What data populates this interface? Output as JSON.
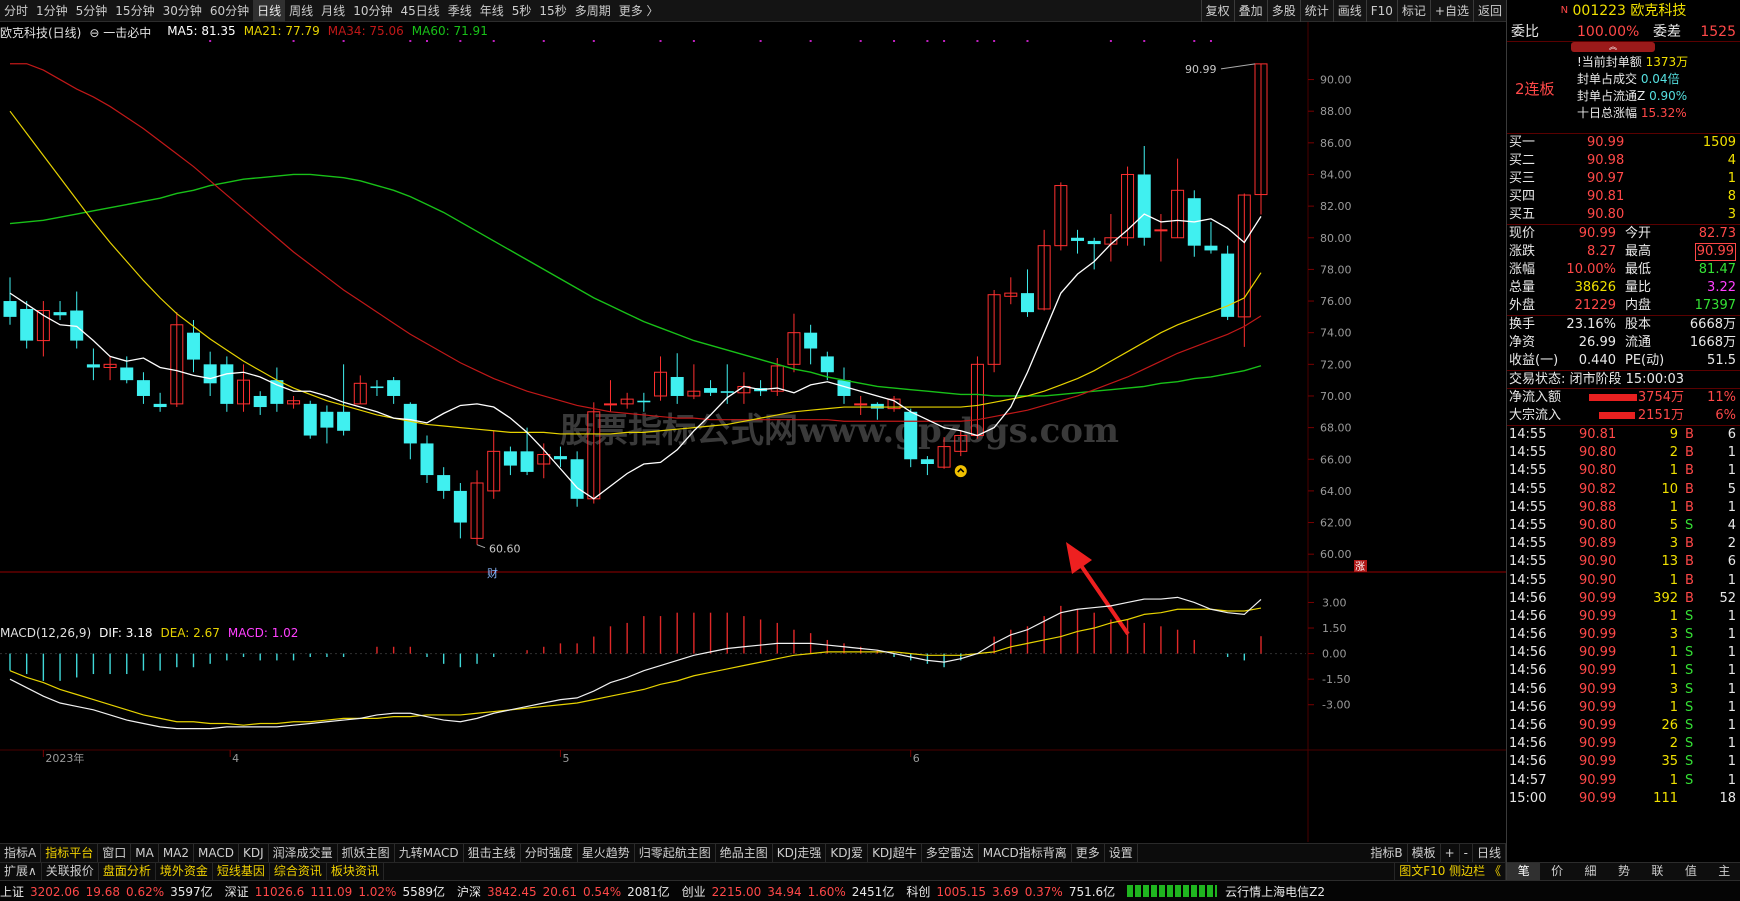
{
  "toolbar": {
    "periods": [
      "分时",
      "1分钟",
      "5分钟",
      "15分钟",
      "30分钟",
      "60分钟",
      "日线",
      "周线",
      "月线",
      "10分钟",
      "45日线",
      "季线",
      "年线",
      "5秒",
      "15秒",
      "多周期",
      "更多 〉"
    ],
    "active": "日线",
    "right": [
      "复权",
      "叠加",
      "多股",
      "统计",
      "画线",
      "F10",
      "标记",
      "+自选",
      "返回"
    ]
  },
  "chart_info": {
    "name": "欧克科技(日线)",
    "formula": "一击必中",
    "ma5": "MA5: 81.35",
    "ma21": "MA21: 77.79",
    "ma34": "MA34: 75.06",
    "ma60": "MA60: 71.91",
    "macd_title": "MACD(12,26,9)",
    "dif": "DIF: 3.18",
    "dea": "DEA: 2.67",
    "macd": "MACD: 1.02"
  },
  "chart_data": {
    "type": "candlestick",
    "dates": [
      "2023年",
      "4",
      "5",
      "6"
    ],
    "price_ticks": [
      "90.00",
      "88.00",
      "86.00",
      "84.00",
      "82.00",
      "80.00",
      "78.00",
      "76.00",
      "74.00",
      "72.00",
      "70.00",
      "68.00",
      "66.00",
      "64.00",
      "62.00",
      "60.00"
    ],
    "macd_ticks": [
      "3.00",
      "1.50",
      "0.00",
      "-1.50",
      "-3.00"
    ],
    "ylim": [
      59,
      92.5
    ],
    "macd_ylim": [
      -4.6,
      4.2
    ],
    "high_label": "90.99",
    "low_label": "60.60",
    "watermark": "股票指标公式网www.gpzbgs.com",
    "marker_cai": "财",
    "marker_zhang": "涨",
    "candles": [
      [
        76,
        75,
        77.5,
        74.5
      ],
      [
        75.5,
        73.5,
        76,
        73
      ],
      [
        73.5,
        75.4,
        76,
        72.5
      ],
      [
        75.3,
        75.1,
        76,
        74.8
      ],
      [
        75.4,
        73.5,
        76.6,
        73
      ],
      [
        72,
        71.8,
        73,
        71
      ],
      [
        71.8,
        72,
        72.5,
        71
      ],
      [
        71.8,
        71,
        72.5,
        70.8
      ],
      [
        71,
        70,
        71.5,
        69.5
      ],
      [
        69.5,
        69.3,
        70.2,
        69
      ],
      [
        69.5,
        74.5,
        75.3,
        69.3
      ],
      [
        74,
        72.3,
        74.8,
        71.5
      ],
      [
        72,
        70.8,
        72.8,
        70
      ],
      [
        72,
        69.5,
        72.5,
        69
      ],
      [
        69.5,
        71,
        72,
        69
      ],
      [
        70,
        69.3,
        70.3,
        68.8
      ],
      [
        71,
        69.5,
        71.8,
        69
      ],
      [
        69.5,
        69.7,
        70,
        69.2
      ],
      [
        69.5,
        67.5,
        69.7,
        67.3
      ],
      [
        69,
        68,
        69.4,
        67
      ],
      [
        69,
        67.8,
        72,
        67.5
      ],
      [
        69.5,
        70.8,
        71.3,
        69.5
      ],
      [
        70.6,
        70.5,
        71,
        70
      ],
      [
        71,
        70,
        71.2,
        69.5
      ],
      [
        69.5,
        67,
        69.6,
        66
      ],
      [
        67,
        65,
        67.5,
        64.5
      ],
      [
        65,
        64,
        65.5,
        63.5
      ],
      [
        64,
        62,
        64.5,
        61
      ],
      [
        61,
        64.5,
        65.3,
        60.6
      ],
      [
        64,
        66.5,
        67.8,
        63.5
      ],
      [
        66.5,
        65.6,
        66.8,
        65
      ],
      [
        66.5,
        65.2,
        68,
        65
      ],
      [
        65.7,
        66.3,
        67,
        64.8
      ],
      [
        66.2,
        66,
        66.8,
        65.5
      ],
      [
        66,
        63.5,
        66.5,
        63
      ],
      [
        63.5,
        69,
        69.6,
        63.2
      ],
      [
        69.5,
        69.5,
        71,
        69
      ],
      [
        69.5,
        69.8,
        70.2,
        69.2
      ],
      [
        69.7,
        69.6,
        70.2,
        69
      ],
      [
        70,
        71.5,
        72.5,
        69.7
      ],
      [
        71.2,
        70,
        72.7,
        69.5
      ],
      [
        70,
        70.3,
        72,
        69.8
      ],
      [
        70.5,
        70.2,
        71,
        70
      ],
      [
        70.3,
        70.2,
        72,
        69.5
      ],
      [
        70.2,
        70.6,
        71.5,
        69.5
      ],
      [
        70.5,
        70.3,
        71,
        70
      ],
      [
        70.3,
        71.9,
        72.4,
        70
      ],
      [
        72,
        74,
        75.2,
        71.5
      ],
      [
        74,
        73,
        74.5,
        72
      ],
      [
        72.5,
        71.5,
        72.8,
        71
      ],
      [
        71,
        70,
        71.8,
        69.5
      ],
      [
        69.5,
        69.5,
        70,
        68.8
      ],
      [
        69.5,
        69.2,
        69.6,
        68.5
      ],
      [
        69.2,
        69.8,
        70,
        69
      ],
      [
        69,
        66,
        69.2,
        65.5
      ],
      [
        66,
        65.7,
        66.2,
        65
      ],
      [
        65.5,
        66.8,
        67.4,
        65.4
      ],
      [
        66.5,
        67.5,
        67.8,
        66.2
      ],
      [
        67.5,
        72,
        72.5,
        67.3
      ],
      [
        72,
        76.4,
        76.7,
        71.5
      ],
      [
        76.3,
        76.5,
        77.5,
        75.8
      ],
      [
        76.5,
        75.3,
        78,
        75
      ],
      [
        75.5,
        79.5,
        80.5,
        75.4
      ],
      [
        79.5,
        83.3,
        83.5,
        79.2
      ],
      [
        80,
        79.8,
        80.5,
        79
      ],
      [
        79.8,
        79.6,
        80,
        78
      ],
      [
        79.6,
        80,
        81.5,
        78.5
      ],
      [
        80,
        84,
        84.5,
        79.5
      ],
      [
        84,
        80,
        85.8,
        79.5
      ],
      [
        80.5,
        80.5,
        81.5,
        78.5
      ],
      [
        80,
        83,
        85,
        80
      ],
      [
        82.5,
        79.5,
        83,
        78.8
      ],
      [
        79.5,
        79.2,
        81,
        79
      ],
      [
        79,
        75,
        79.5,
        74.8
      ],
      [
        75,
        82.7,
        82.8,
        73.1
      ],
      [
        82.73,
        90.99,
        90.99,
        81.47
      ]
    ],
    "ma5": [
      76.5,
      75.8,
      75.1,
      74.5,
      74.4,
      73.5,
      72.5,
      72.2,
      72.4,
      71.8,
      71.6,
      71.3,
      71.1,
      71.4,
      71.5,
      71.2,
      70.7,
      70.3,
      70.3,
      70.0,
      69.6,
      69.3,
      69.0,
      68.6,
      68.5,
      68.3,
      68.9,
      69.4,
      69.5,
      69.3,
      68.6,
      67.7,
      66.6,
      65.4,
      64.2,
      63.5,
      64.3,
      65.1,
      65.7,
      65.8,
      66.6,
      67.8,
      68.8,
      69.9,
      70.6,
      70.4,
      70.5,
      70.2,
      70.7,
      70.9,
      70.6,
      70.3,
      70.0,
      69.7,
      69.0,
      68.5,
      68.0,
      67.8,
      67.5,
      68.0,
      69.3,
      71.5,
      74.0,
      76.5,
      77.7,
      78.5,
      79.6,
      80.5,
      81.5,
      81.0,
      81.1,
      81.0,
      81.2,
      80.6,
      79.7,
      81.35
    ],
    "ma21": [
      88.0,
      86.6,
      85.2,
      83.8,
      82.4,
      81.0,
      79.7,
      78.5,
      77.3,
      76.2,
      75.2,
      74.4,
      73.6,
      72.9,
      72.2,
      71.6,
      71.0,
      70.5,
      70.1,
      69.7,
      69.4,
      69.1,
      68.8,
      68.6,
      68.4,
      68.2,
      68.1,
      68.0,
      67.9,
      67.8,
      67.7,
      67.7,
      67.7,
      67.6,
      67.6,
      67.6,
      67.6,
      67.7,
      67.7,
      67.8,
      67.9,
      68.0,
      68.1,
      68.2,
      68.4,
      68.6,
      68.8,
      69.0,
      69.1,
      69.2,
      69.3,
      69.3,
      69.3,
      69.3,
      69.3,
      69.3,
      69.3,
      69.3,
      69.4,
      69.6,
      69.8,
      70.0,
      70.3,
      70.7,
      71.1,
      71.6,
      72.2,
      72.8,
      73.4,
      74.0,
      74.5,
      74.9,
      75.3,
      75.7,
      76.2,
      77.79
    ],
    "ma34": [
      91.0,
      91.0,
      90.6,
      90.0,
      89.4,
      88.9,
      88.3,
      87.6,
      86.9,
      86.1,
      85.3,
      84.5,
      83.6,
      82.7,
      81.8,
      80.9,
      80.0,
      79.1,
      78.3,
      77.5,
      76.7,
      76.0,
      75.3,
      74.6,
      73.9,
      73.3,
      72.7,
      72.1,
      71.6,
      71.1,
      70.7,
      70.3,
      70.0,
      69.7,
      69.4,
      69.2,
      69.0,
      68.9,
      68.8,
      68.7,
      68.6,
      68.6,
      68.5,
      68.5,
      68.5,
      68.5,
      68.5,
      68.5,
      68.5,
      68.5,
      68.4,
      68.4,
      68.4,
      68.4,
      68.4,
      68.4,
      68.4,
      68.4,
      68.5,
      68.7,
      68.9,
      69.1,
      69.4,
      69.7,
      70.0,
      70.4,
      70.8,
      71.2,
      71.7,
      72.2,
      72.7,
      73.1,
      73.5,
      73.9,
      74.4,
      75.06
    ],
    "ma60": [
      80.9,
      81.0,
      81.1,
      81.3,
      81.5,
      81.7,
      81.9,
      82.1,
      82.3,
      82.5,
      82.8,
      83.0,
      83.3,
      83.5,
      83.7,
      83.8,
      83.9,
      84.0,
      84.0,
      83.9,
      83.8,
      83.6,
      83.3,
      83.0,
      82.6,
      82.1,
      81.6,
      81.0,
      80.4,
      79.8,
      79.2,
      78.6,
      78.0,
      77.4,
      76.8,
      76.2,
      75.7,
      75.2,
      74.7,
      74.3,
      73.9,
      73.5,
      73.2,
      72.9,
      72.6,
      72.3,
      72.0,
      71.7,
      71.5,
      71.2,
      71.0,
      70.8,
      70.6,
      70.5,
      70.4,
      70.3,
      70.2,
      70.1,
      70.1,
      70.0,
      70.0,
      70.0,
      70.0,
      70.1,
      70.2,
      70.3,
      70.4,
      70.5,
      70.6,
      70.8,
      70.9,
      71.1,
      71.2,
      71.4,
      71.6,
      71.91
    ],
    "dif": [
      -1.5,
      -2.0,
      -2.5,
      -2.9,
      -3.1,
      -3.3,
      -3.6,
      -3.9,
      -4.1,
      -4.3,
      -4.4,
      -4.4,
      -4.4,
      -4.3,
      -4.3,
      -4.3,
      -4.3,
      -4.2,
      -4.1,
      -4.0,
      -3.9,
      -3.8,
      -3.6,
      -3.5,
      -3.5,
      -3.7,
      -3.9,
      -4.0,
      -3.8,
      -3.5,
      -3.3,
      -3.1,
      -2.9,
      -2.7,
      -2.6,
      -2.2,
      -1.7,
      -1.4,
      -1.0,
      -0.7,
      -0.4,
      -0.1,
      0.1,
      0.3,
      0.4,
      0.5,
      0.6,
      0.6,
      0.6,
      0.5,
      0.4,
      0.3,
      0.2,
      0.0,
      -0.2,
      -0.4,
      -0.5,
      -0.3,
      0.0,
      0.6,
      1.1,
      1.4,
      1.9,
      2.4,
      2.6,
      2.7,
      2.8,
      3.0,
      3.2,
      3.2,
      3.3,
      3.0,
      2.6,
      2.4,
      2.3,
      3.18
    ],
    "dea": [
      -1.0,
      -1.4,
      -1.7,
      -2.1,
      -2.4,
      -2.7,
      -3.0,
      -3.3,
      -3.6,
      -3.8,
      -4.0,
      -4.0,
      -4.1,
      -4.1,
      -4.2,
      -4.1,
      -4.1,
      -4.0,
      -4.0,
      -3.9,
      -3.8,
      -3.8,
      -3.8,
      -3.7,
      -3.7,
      -3.6,
      -3.6,
      -3.6,
      -3.5,
      -3.4,
      -3.3,
      -3.2,
      -3.1,
      -3.0,
      -2.9,
      -2.7,
      -2.5,
      -2.3,
      -2.1,
      -1.8,
      -1.6,
      -1.3,
      -1.1,
      -0.9,
      -0.7,
      -0.5,
      -0.3,
      -0.1,
      0.0,
      0.1,
      0.1,
      0.1,
      0.1,
      0.1,
      0.0,
      -0.1,
      -0.1,
      -0.1,
      0.0,
      0.1,
      0.4,
      0.6,
      0.8,
      1.0,
      1.3,
      1.5,
      1.8,
      2.0,
      2.3,
      2.4,
      2.6,
      2.6,
      2.6,
      2.5,
      2.5,
      2.67
    ],
    "signal_index": 57
  },
  "sidebar": {
    "logo": "N",
    "code": "001223",
    "name": "欧克科技",
    "weibi_label": "委比",
    "weibi": "100.00%",
    "weicha_label": "委差",
    "weicha": "1525",
    "lianban": "2连板",
    "seal": [
      [
        "!当前封单额",
        "1373万",
        "yel"
      ],
      [
        "封单占成交",
        "0.04倍",
        "cyn"
      ],
      [
        "封单占流通Z",
        "0.90%",
        "cyn"
      ],
      [
        "十日总涨幅",
        "15.32%",
        "red"
      ]
    ],
    "buy": [
      [
        "买一",
        "90.99",
        "1509"
      ],
      [
        "买二",
        "90.98",
        "4"
      ],
      [
        "买三",
        "90.97",
        "1"
      ],
      [
        "买四",
        "90.81",
        "8"
      ],
      [
        "买五",
        "90.80",
        "3"
      ]
    ],
    "quote": [
      [
        "现价",
        "90.99",
        "red",
        "今开",
        "82.73",
        "red"
      ],
      [
        "涨跌",
        "8.27",
        "red",
        "最高",
        "90.99",
        "red"
      ],
      [
        "涨幅",
        "10.00%",
        "red",
        "最低",
        "81.47",
        "grn"
      ],
      [
        "总量",
        "38626",
        "yel",
        "量比",
        "3.22",
        "mag"
      ],
      [
        "外盘",
        "21229",
        "red",
        "内盘",
        "17397",
        "grn"
      ]
    ],
    "stats": [
      [
        "换手",
        "23.16%",
        "股本",
        "6668万"
      ],
      [
        "净资",
        "26.99",
        "流通",
        "1668万"
      ],
      [
        "收益(一)",
        "0.440",
        "PE(动)",
        "51.5"
      ]
    ],
    "trade_status": "交易状态: 闭市阶段 15:00:03",
    "flow": [
      [
        "净流入额",
        "3754万",
        "11%"
      ],
      [
        "大宗流入",
        "2151万",
        "6%"
      ]
    ],
    "ticks": [
      [
        "14:55",
        "90.81",
        "9",
        "B",
        "6"
      ],
      [
        "14:55",
        "90.80",
        "2",
        "B",
        "1"
      ],
      [
        "14:55",
        "90.80",
        "1",
        "B",
        "1"
      ],
      [
        "14:55",
        "90.82",
        "10",
        "B",
        "5"
      ],
      [
        "14:55",
        "90.88",
        "1",
        "B",
        "1"
      ],
      [
        "14:55",
        "90.80",
        "5",
        "S",
        "4"
      ],
      [
        "14:55",
        "90.89",
        "3",
        "B",
        "2"
      ],
      [
        "14:55",
        "90.90",
        "13",
        "B",
        "6"
      ],
      [
        "14:55",
        "90.90",
        "1",
        "B",
        "1"
      ],
      [
        "14:56",
        "90.99",
        "392",
        "B",
        "52"
      ],
      [
        "14:56",
        "90.99",
        "1",
        "S",
        "1"
      ],
      [
        "14:56",
        "90.99",
        "3",
        "S",
        "1"
      ],
      [
        "14:56",
        "90.99",
        "1",
        "S",
        "1"
      ],
      [
        "14:56",
        "90.99",
        "1",
        "S",
        "1"
      ],
      [
        "14:56",
        "90.99",
        "3",
        "S",
        "1"
      ],
      [
        "14:56",
        "90.99",
        "1",
        "S",
        "1"
      ],
      [
        "14:56",
        "90.99",
        "26",
        "S",
        "1"
      ],
      [
        "14:56",
        "90.99",
        "2",
        "S",
        "1"
      ],
      [
        "14:56",
        "90.99",
        "35",
        "S",
        "1"
      ],
      [
        "14:57",
        "90.99",
        "1",
        "S",
        "1"
      ],
      [
        "15:00",
        "90.99",
        "111",
        "",
        "18"
      ]
    ],
    "tabs": [
      "笔",
      "价",
      "細",
      "势",
      "联",
      "值",
      "主"
    ]
  },
  "bottom_tabs": [
    "指标A",
    "指标平台",
    "窗口",
    "MA",
    "MA2",
    "MACD",
    "KDJ",
    "润泽成交量",
    "抓妖主图",
    "九转MACD",
    "狙击主线",
    "分时强度",
    "星火趋势",
    "归零起航主图",
    "绝品主图",
    "KDJ走强",
    "KDJ爱",
    "KDJ超牛",
    "多空雷达",
    "MACD指标背离",
    "更多",
    "设置"
  ],
  "bottom_tabs_right": [
    "指标B",
    "模板",
    "+",
    "-",
    "日线"
  ],
  "bottom_tabs2": [
    "扩展∧",
    "关联报价",
    "盘面分析",
    "境外资金",
    "短线基因",
    "综合资讯",
    "板块资讯"
  ],
  "bottom_tabs2_right": "图文F10 侧边栏 《",
  "status": [
    [
      "上证",
      "3202.06",
      "19.68",
      "0.62%",
      "3597亿"
    ],
    [
      "深证",
      "11026.6",
      "111.09",
      "1.02%",
      "5589亿"
    ],
    [
      "沪深",
      "3842.45",
      "20.61",
      "0.54%",
      "2081亿"
    ],
    [
      "创业",
      "2215.00",
      "34.94",
      "1.60%",
      "2451亿"
    ],
    [
      "科创",
      "1005.15",
      "3.69",
      "0.37%",
      "751.6亿"
    ]
  ],
  "status_right": "云行情上海电信Z2",
  "colors": {
    "up": "#ff3030",
    "down": "#40f0f0",
    "ma5": "#ffffff",
    "ma21": "#e6d200",
    "ma34": "#c01818",
    "ma60": "#18c018",
    "macd_up": "#e02828",
    "macd_down": "#40d8d8",
    "dif": "#f0f0f0",
    "dea": "#e6d200"
  }
}
